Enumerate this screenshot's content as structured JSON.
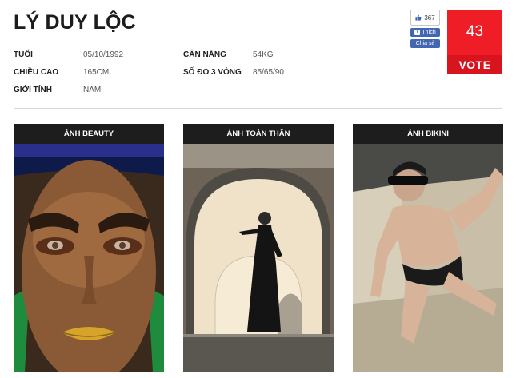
{
  "profile": {
    "name": "LÝ DUY LỘC",
    "fields": [
      {
        "label": "TUỔI",
        "value": "05/10/1992"
      },
      {
        "label": "CÂN NẶNG",
        "value": "54KG"
      },
      {
        "label": "CHIỀU CAO",
        "value": "165CM"
      },
      {
        "label": "SỐ ĐO 3 VÒNG",
        "value": "85/65/90"
      },
      {
        "label": "GIỚI TÍNH",
        "value": "NAM"
      }
    ]
  },
  "social": {
    "like_count": "367",
    "like_label": "Thích",
    "share_label": "Chia sẻ"
  },
  "vote": {
    "count": "43",
    "label": "VOTE",
    "color": "#ef1d26"
  },
  "gallery": [
    {
      "title": "ẢNH BEAUTY"
    },
    {
      "title": "ẢNH TOÀN THÂN"
    },
    {
      "title": "ẢNH BIKINI"
    }
  ]
}
